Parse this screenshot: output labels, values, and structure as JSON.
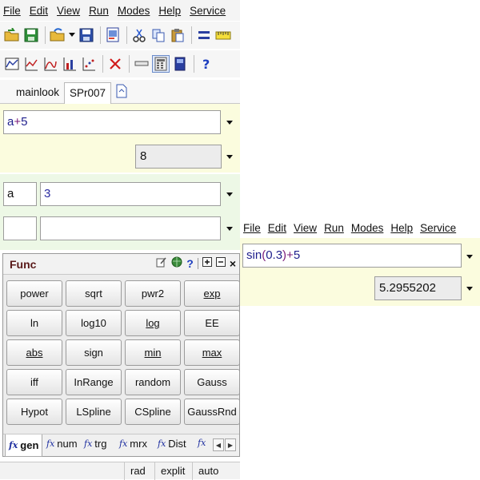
{
  "menu": [
    "File",
    "Edit",
    "View",
    "Run",
    "Modes",
    "Help",
    "Service"
  ],
  "tabs": [
    "mainlook",
    "SPr007"
  ],
  "expression": {
    "parts": [
      "a",
      "+",
      "5"
    ],
    "result": "8"
  },
  "variables": [
    {
      "name": "a",
      "value": "3"
    },
    {
      "name": "",
      "value": ""
    }
  ],
  "func_panel": {
    "title": "Func",
    "buttons": [
      "power",
      "sqrt",
      "pwr2",
      "exp",
      "ln",
      "log10",
      "log",
      "EE",
      "abs",
      "sign",
      "min",
      "max",
      "iff",
      "InRange",
      "random",
      "Gauss",
      "Hypot",
      "LSpline",
      "CSpline",
      "GaussRnd"
    ],
    "tab_prefix": "fx",
    "tabs": [
      "gen",
      "num",
      "trg",
      "mrx",
      "Dist"
    ]
  },
  "status": [
    "rad",
    "explit",
    "auto"
  ],
  "second_window": {
    "menu": [
      "File",
      "Edit",
      "View",
      "Run",
      "Modes",
      "Help",
      "Service"
    ],
    "expression": {
      "parts": [
        "sin",
        "(",
        "0.3",
        ")",
        "+",
        "5"
      ]
    },
    "result": "5.2955202"
  }
}
